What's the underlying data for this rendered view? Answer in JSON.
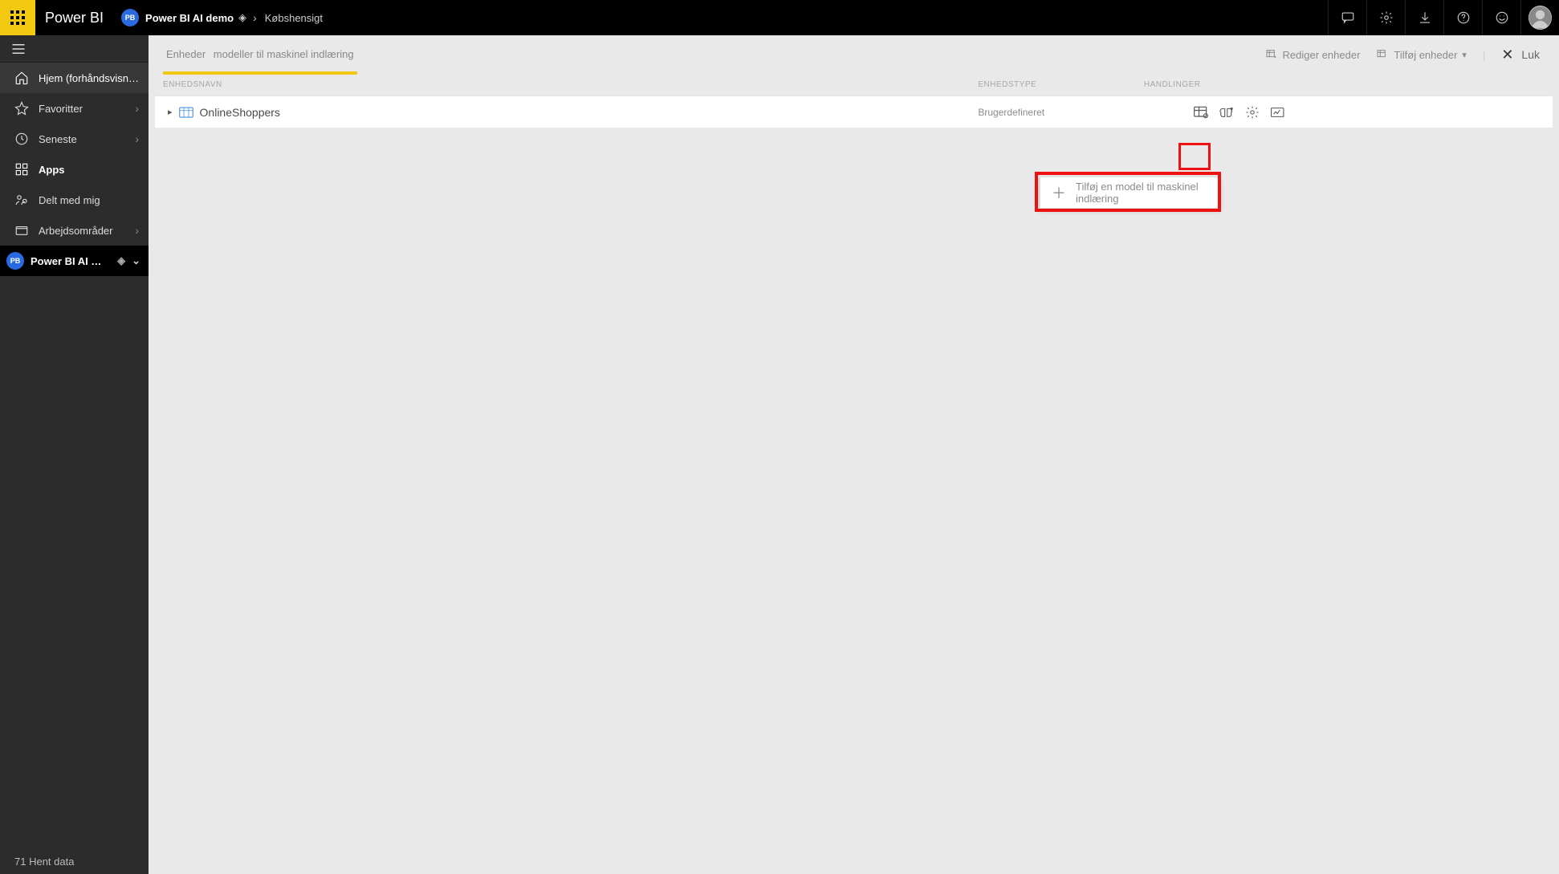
{
  "brand": "Power BI",
  "breadcrumb": {
    "workspace_badge": "PB",
    "workspace": "Power BI AI demo",
    "current": "Købshensigt"
  },
  "sidebar": {
    "home": "Hjem (forhåndsvisning)",
    "favorites": "Favoritter",
    "recent": "Seneste",
    "apps": "Apps",
    "shared": "Delt med mig",
    "workspaces": "Arbejdsområder",
    "workspace_selector": {
      "badge": "PB",
      "label": "Power BI AI …"
    },
    "bottom": "71 Hent data"
  },
  "tabs": {
    "entities": "Enheder",
    "ml_models": "modeller til maskinel indlæring"
  },
  "toolbar": {
    "edit_entities": "Rediger enheder",
    "add_entities": "Tilføj enheder",
    "close": "Luk"
  },
  "columns": {
    "name": "ENHEDSNAVN",
    "type": "ENHEDSTYPE",
    "actions": "HANDLINGER"
  },
  "rows": [
    {
      "name": "OnlineShoppers",
      "type": "Brugerdefineret"
    }
  ],
  "dropdown": {
    "add_ml_model": "Tilføj en model til maskinel indlæring"
  }
}
